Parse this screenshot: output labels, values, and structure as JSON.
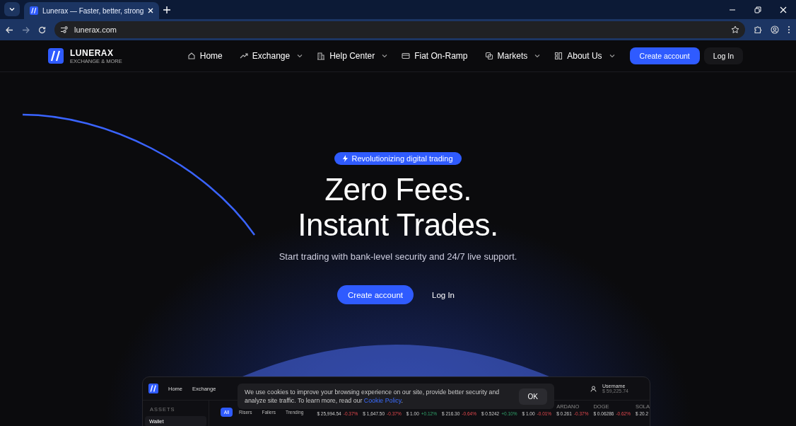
{
  "browser": {
    "tab_title": "Lunerax — Faster, better, strong",
    "url": "lunerax.com"
  },
  "site_nav": {
    "logo_name": "LUNERAX",
    "logo_tagline": "EXCHANGE & MORE",
    "items": [
      {
        "label": "Home",
        "has_dropdown": false
      },
      {
        "label": "Exchange",
        "has_dropdown": true
      },
      {
        "label": "Help Center",
        "has_dropdown": true
      },
      {
        "label": "Fiat On-Ramp",
        "has_dropdown": false
      },
      {
        "label": "Markets",
        "has_dropdown": true
      },
      {
        "label": "About Us",
        "has_dropdown": true
      }
    ],
    "create_account": "Create account",
    "log_in": "Log In"
  },
  "hero": {
    "badge": "Revolutionizing digital trading",
    "headline_1": "Zero Fees.",
    "headline_2": "Instant Trades.",
    "subtitle": "Start trading with bank-level security and 24/7 live support.",
    "create_account": "Create account",
    "log_in": "Log In"
  },
  "preview": {
    "nav": [
      "Home",
      "Exchange"
    ],
    "assets_label": "ASSETS",
    "wallet": "Wallet",
    "username": "Username",
    "balance": "$ 59,225.74",
    "filters": [
      {
        "label": "All",
        "selected": true
      },
      {
        "label": "Risers",
        "selected": false
      },
      {
        "label": "Fallers",
        "selected": false
      },
      {
        "label": "Trending",
        "selected": false
      }
    ],
    "tickers": [
      {
        "price": "$ 25,994.54",
        "change": "-0.37%",
        "kind": "loss"
      },
      {
        "price": "$ 1,647.50",
        "change": "-0.37%",
        "kind": "loss"
      },
      {
        "price": "$ 1.00",
        "change": "+0.12%",
        "kind": "gain"
      },
      {
        "price": "$ 216.30",
        "change": "-0.64%",
        "kind": "loss"
      },
      {
        "price": "$ 0.5242",
        "change": "+0.10%",
        "kind": "gain"
      },
      {
        "price": "$ 1.00",
        "change": "-0.01%",
        "kind": "loss"
      },
      {
        "name": "ARDANO",
        "price": "$ 0.261",
        "change": "-0.37%",
        "kind": "loss"
      },
      {
        "name": "DOGE",
        "price": "$ 0.06286",
        "change": "-0.62%",
        "kind": "loss"
      },
      {
        "name": "SOLA",
        "price": "$ 20.2"
      }
    ]
  },
  "cookie_banner": {
    "text": "We use cookies to improve your browsing experience on our site, provide better security and analyze site traffic. To learn more, read our ",
    "link": "Cookie Policy",
    "after": ".",
    "ok": "OK"
  }
}
